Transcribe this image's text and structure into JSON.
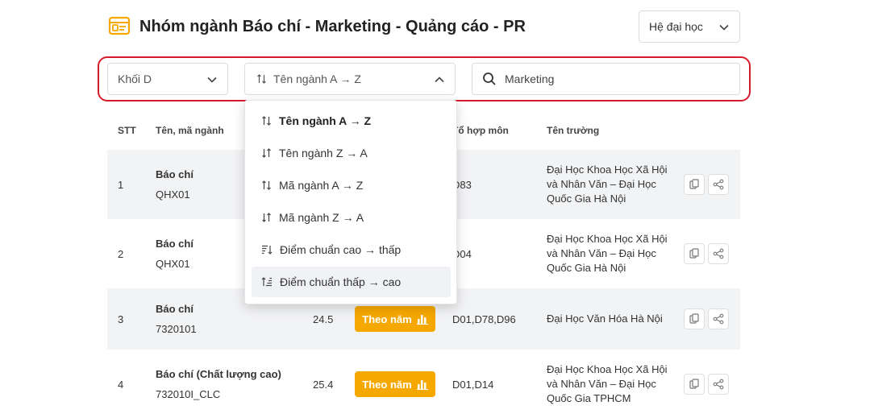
{
  "header": {
    "title": "Nhóm ngành Báo chí - Marketing - Quảng cáo - PR",
    "level_select": "Hệ đại học"
  },
  "filters": {
    "block": "Khối D",
    "sort": "Tên ngành A → Z",
    "search_value": "Marketing"
  },
  "sort_options": [
    {
      "label": "Tên ngành A → Z",
      "icon": "sort-az-icon"
    },
    {
      "label": "Tên ngành Z → A",
      "icon": "sort-za-icon"
    },
    {
      "label": "Mã ngành A → Z",
      "icon": "sort-az-icon"
    },
    {
      "label": "Mã ngành Z → A",
      "icon": "sort-za-icon"
    },
    {
      "label": "Điểm chuẩn cao → thấp",
      "icon": "sort-desc-icon"
    },
    {
      "label": "Điểm chuẩn thấp → cao",
      "icon": "sort-asc-icon"
    }
  ],
  "table": {
    "headers": {
      "stt": "STT",
      "name": "Tên, mã ngành",
      "combo": "Tổ hợp môn",
      "school": "Tên trường"
    },
    "year_button_label": "Theo năm",
    "rows": [
      {
        "stt": "1",
        "name": "Báo chí",
        "code": "QHX01",
        "score": "",
        "combo": "D83",
        "school": "Đại Học Khoa Học Xã Hội và Nhân Văn – Đại Học Quốc Gia Hà Nội"
      },
      {
        "stt": "2",
        "name": "Báo chí",
        "code": "QHX01",
        "score": "",
        "combo": "D04",
        "school": "Đại Học Khoa Học Xã Hội và Nhân Văn – Đại Học Quốc Gia Hà Nội"
      },
      {
        "stt": "3",
        "name": "Báo chí",
        "code": "7320101",
        "score": "24.5",
        "combo": "D01,D78,D96",
        "school": "Đại Học Văn Hóa Hà Nội"
      },
      {
        "stt": "4",
        "name": "Báo chí (Chất lượng cao)",
        "code": "732010I_CLC",
        "score": "25.4",
        "combo": "D01,D14",
        "school": "Đại Học Khoa Học Xã Hội và Nhân Văn – Đại Học Quốc Gia TPHCM"
      }
    ]
  },
  "colors": {
    "accent": "#f5a800",
    "highlight_frame": "#d81b2a"
  }
}
